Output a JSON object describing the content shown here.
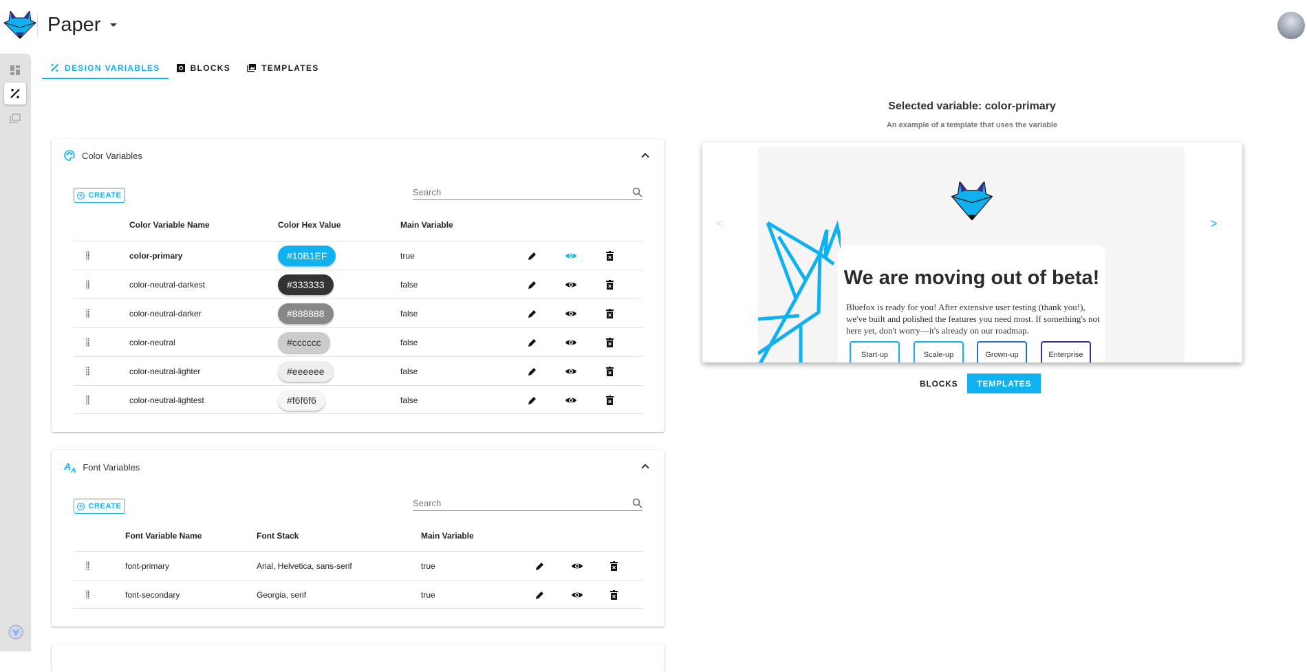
{
  "app": {
    "title": "Paper"
  },
  "colors": {
    "accent": "#10b1ef",
    "purple": "#3b2d8f"
  },
  "tabs": [
    {
      "label": "DESIGN VARIABLES",
      "icon": "design-tools-icon",
      "active": true
    },
    {
      "label": "BLOCKS",
      "icon": "blocks-icon"
    },
    {
      "label": "TEMPLATES",
      "icon": "templates-icon"
    }
  ],
  "color_section": {
    "title": "Color Variables",
    "create_label": "CREATE",
    "search_placeholder": "Search",
    "columns": [
      "Color Variable Name",
      "Color Hex Value",
      "Main Variable"
    ],
    "rows": [
      {
        "name": "color-primary",
        "hex": "#10B1EF",
        "main": "true",
        "bg": "#10b1ef",
        "fg": "#ffffff",
        "selected": true
      },
      {
        "name": "color-neutral-darkest",
        "hex": "#333333",
        "main": "false",
        "bg": "#333333",
        "fg": "#ffffff"
      },
      {
        "name": "color-neutral-darker",
        "hex": "#888888",
        "main": "false",
        "bg": "#888888",
        "fg": "#ffffff"
      },
      {
        "name": "color-neutral",
        "hex": "#cccccc",
        "main": "false",
        "bg": "#cccccc",
        "fg": "#333333"
      },
      {
        "name": "color-neutral-lighter",
        "hex": "#eeeeee",
        "main": "false",
        "bg": "#eeeeee",
        "fg": "#333333"
      },
      {
        "name": "color-neutral-lightest",
        "hex": "#f6f6f6",
        "main": "false",
        "bg": "#f6f6f6",
        "fg": "#333333"
      }
    ]
  },
  "font_section": {
    "title": "Font Variables",
    "create_label": "CREATE",
    "search_placeholder": "Search",
    "columns": [
      "Font Variable Name",
      "Font Stack",
      "Main Variable"
    ],
    "rows": [
      {
        "name": "font-primary",
        "stack": "Arial, Helvetica, sans-serif",
        "main": "true"
      },
      {
        "name": "font-secondary",
        "stack": "Georgia, serif",
        "main": "true"
      }
    ]
  },
  "preview": {
    "title": "Selected variable: color-primary",
    "subtitle": "An example of a template that uses the variable",
    "email_heading": "We are moving out of beta!",
    "email_body": "Bluefox is ready for you! After extensive user testing (thank you!), we've built and polished the features you need most. If something's not here yet, don't worry—it's already on our roadmap.",
    "plans": [
      "Start-up",
      "Scale-up",
      "Grown-up",
      "Enterprise"
    ],
    "prev": "<",
    "next": ">",
    "toggle": [
      {
        "label": "BLOCKS"
      },
      {
        "label": "TEMPLATES",
        "active": true
      }
    ]
  }
}
